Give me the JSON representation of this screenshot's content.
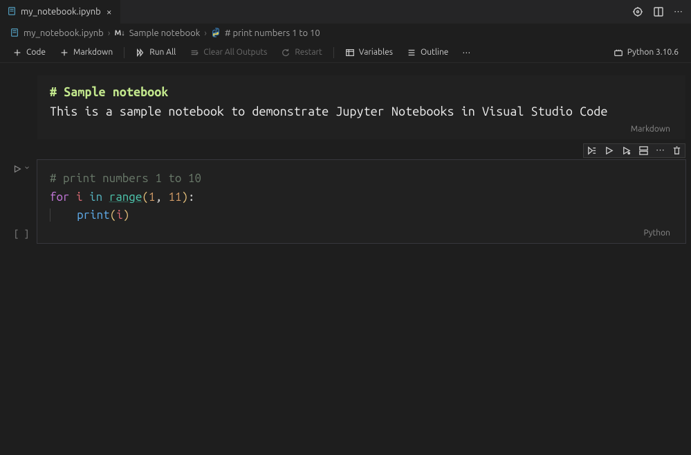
{
  "tab": {
    "filename": "my_notebook.ipynb"
  },
  "breadcrumb": {
    "file": "my_notebook.ipynb",
    "section": "Sample notebook",
    "cell": "# print numbers 1 to 10"
  },
  "toolbar": {
    "code": "Code",
    "markdown": "Markdown",
    "run_all": "Run All",
    "clear_outputs": "Clear All Outputs",
    "restart": "Restart",
    "variables": "Variables",
    "outline": "Outline",
    "kernel": "Python 3.10.6"
  },
  "cells": {
    "markdown_cell": {
      "heading": "# Sample notebook",
      "text": "This is a sample notebook to demonstrate Jupyter Notebooks in Visual Studio Code",
      "lang": "Markdown"
    },
    "code_cell": {
      "exec_indicator": "[ ]",
      "comment": "# print numbers 1 to 10",
      "kw_for": "for",
      "var_i": "i",
      "kw_in": "in",
      "fn_range": "range",
      "lp": "(",
      "n1": "1",
      "comma": ", ",
      "n2": "11",
      "rp": ")",
      "colon": ":",
      "indent": "    ",
      "fn_print": "print",
      "lp2": "(",
      "var_i2": "i",
      "rp2": ")",
      "lang": "Python"
    }
  },
  "misc": {
    "more": "⋯",
    "md_badge": "M↓"
  }
}
